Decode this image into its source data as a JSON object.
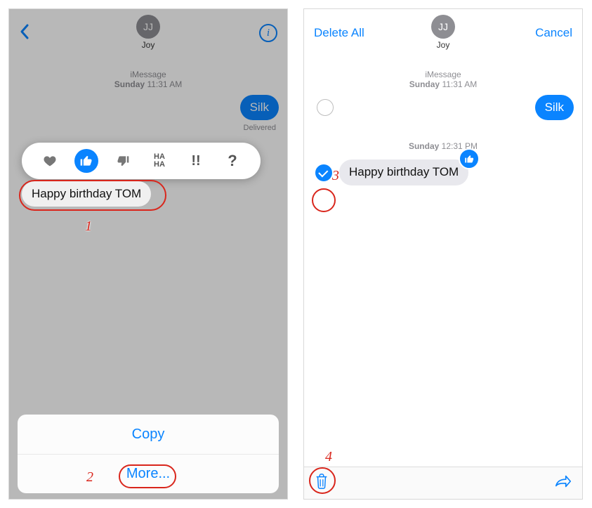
{
  "left": {
    "avatarInitials": "JJ",
    "contact": "Joy",
    "ts_service": "iMessage",
    "ts_day": "Sunday",
    "ts_time": "11:31 AM",
    "sent1": "Silk",
    "delivered": "Delivered",
    "recv1": "Happy birthday TOM",
    "sheet_copy": "Copy",
    "sheet_more": "More...",
    "callout1": "1",
    "callout2": "2",
    "tapbacks": [
      "heart",
      "like",
      "dislike",
      "haha",
      "exclaim",
      "question"
    ]
  },
  "right": {
    "deleteAll": "Delete All",
    "cancel": "Cancel",
    "avatarInitials": "JJ",
    "contact": "Joy",
    "ts_service": "iMessage",
    "ts_day": "Sunday",
    "ts_time": "11:31 AM",
    "sent1": "Silk",
    "ts2_day": "Sunday",
    "ts2_time": "12:31 PM",
    "recv1": "Happy birthday TOM",
    "callout3": "3",
    "callout4": "4"
  }
}
